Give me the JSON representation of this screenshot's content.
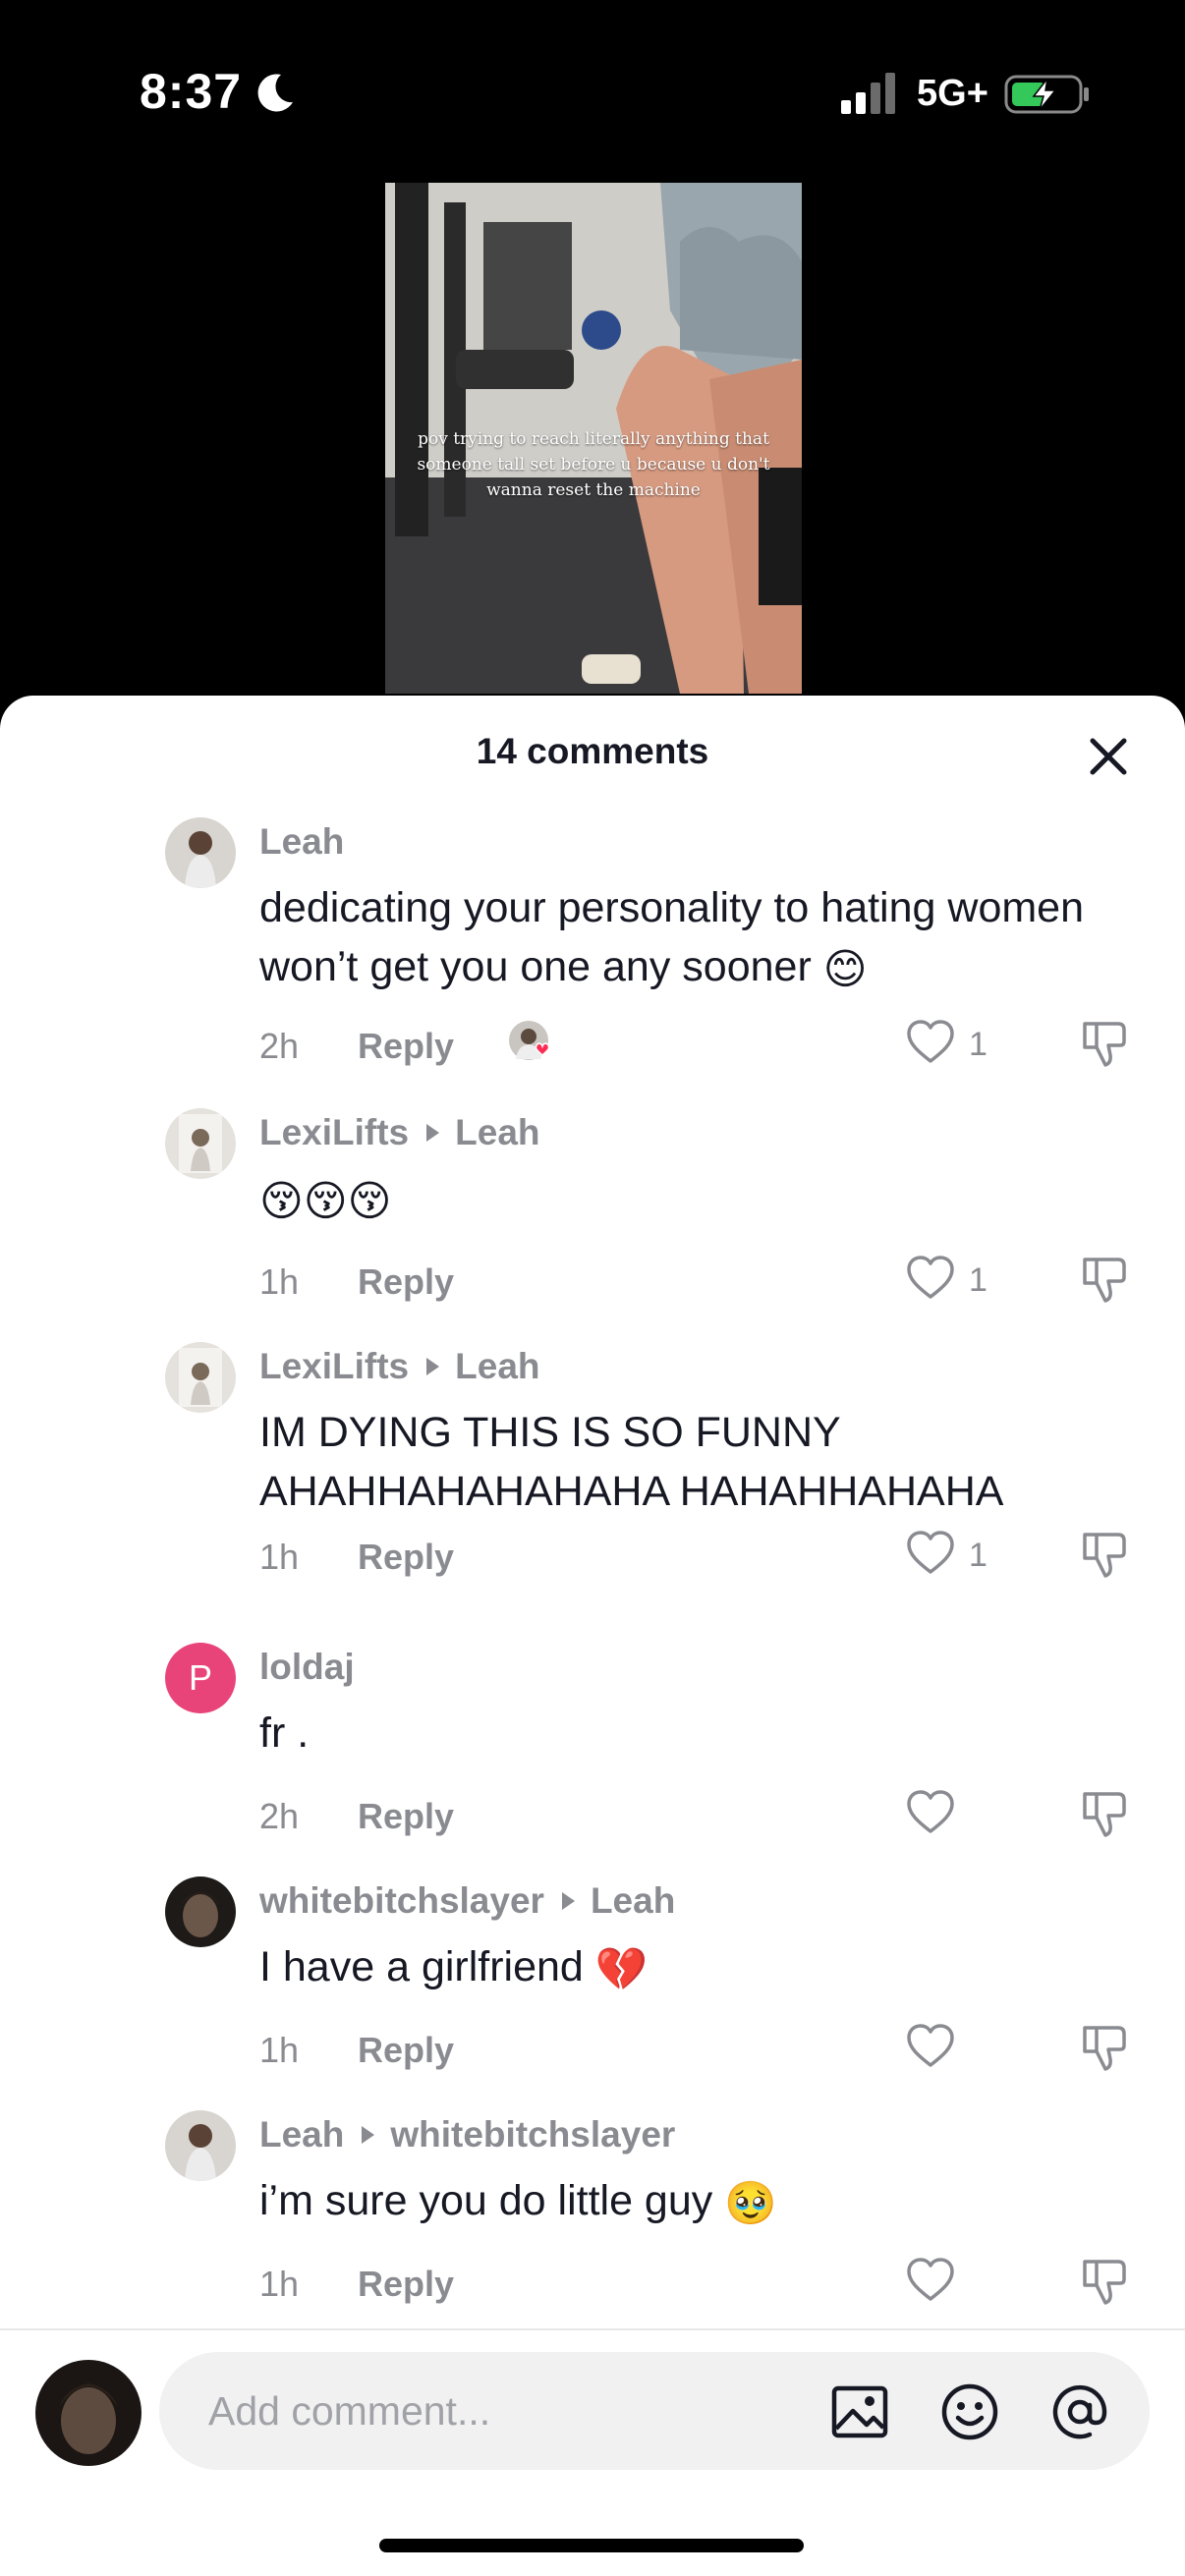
{
  "status_bar": {
    "time": "8:37",
    "network": "5G+"
  },
  "video": {
    "overlay_text": "pov trying to reach literally anything that someone tall set before u because u don't wanna reset the machine"
  },
  "sheet": {
    "title": "14 comments"
  },
  "comments": [
    {
      "username": "Leah",
      "reply_to": "",
      "text": "dedicating your personality to hating women won’t get you one any sooner",
      "emoji": "😊",
      "time": "2h",
      "reply_label": "Reply",
      "likes": "1"
    },
    {
      "username": "LexiLifts",
      "reply_to": "Leah",
      "text": "",
      "emoji": "😚😚😚",
      "time": "1h",
      "reply_label": "Reply",
      "likes": "1"
    },
    {
      "username": "LexiLifts",
      "reply_to": "Leah",
      "text": "IM DYING THIS IS SO FUNNY AHAHHAHAHAHAHA HAHAHHAHAHA",
      "emoji": "",
      "time": "1h",
      "reply_label": "Reply",
      "likes": "1"
    },
    {
      "username": "loldaj",
      "avatar_letter": "P",
      "reply_to": "",
      "text": "fr .",
      "emoji": "",
      "time": "2h",
      "reply_label": "Reply",
      "likes": ""
    },
    {
      "username": "whitebitchslayer",
      "reply_to": "Leah",
      "text": "I have a girlfriend",
      "emoji": "💔",
      "time": "1h",
      "reply_label": "Reply",
      "likes": ""
    },
    {
      "username": "Leah",
      "reply_to": "whitebitchslayer",
      "text": "i’m sure you do little guy",
      "emoji": "🥹",
      "time": "1h",
      "reply_label": "Reply",
      "likes": ""
    }
  ],
  "composer": {
    "placeholder": "Add comment..."
  },
  "colors": {
    "muted": "#8a8b91",
    "text": "#161823",
    "heart": "#fe2c55",
    "letter_avatar": "#e8447a"
  }
}
